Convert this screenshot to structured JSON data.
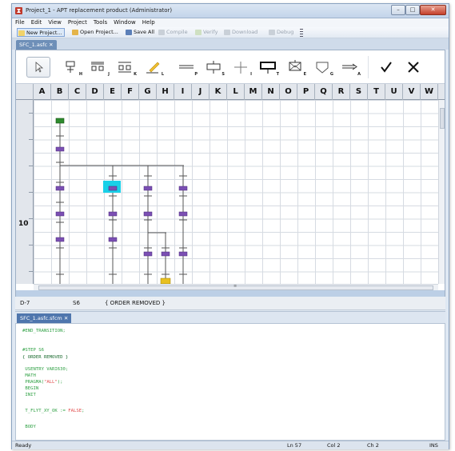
{
  "window": {
    "title": "Project_1 - APT replacement product (Administrator)"
  },
  "menu": [
    "File",
    "Edit",
    "View",
    "Project",
    "Tools",
    "Window",
    "Help"
  ],
  "toolbar": {
    "new_project": "New Project...",
    "open_project": "Open Project...",
    "save_all": "Save All",
    "compile": "Compile",
    "verify": "Verify",
    "download": "Download",
    "debug": "Debug"
  },
  "document_tab": "SFC_1.asfc",
  "palette": [
    {
      "name": "pointer",
      "key": ""
    },
    {
      "name": "step",
      "key": "H"
    },
    {
      "name": "parallel-branch",
      "key": "J"
    },
    {
      "name": "alternative-branch",
      "key": "K"
    },
    {
      "name": "comment",
      "key": "L"
    },
    {
      "name": "double-line",
      "key": "P"
    },
    {
      "name": "macro-step",
      "key": "S"
    },
    {
      "name": "cross",
      "key": "I"
    },
    {
      "name": "step-block",
      "key": "T"
    },
    {
      "name": "envelope-step",
      "key": "E"
    },
    {
      "name": "shield",
      "key": "G"
    },
    {
      "name": "jump",
      "key": "A"
    },
    {
      "name": "check",
      "key": ""
    },
    {
      "name": "cancel",
      "key": ""
    }
  ],
  "columns": [
    "A",
    "B",
    "C",
    "D",
    "E",
    "F",
    "G",
    "H",
    "I",
    "J",
    "K",
    "L",
    "M",
    "N",
    "O",
    "P",
    "Q",
    "R",
    "S",
    "T",
    "U",
    "V",
    "W"
  ],
  "row_label": "10",
  "info": {
    "cell": "D-7",
    "step": "S6",
    "comment": "{ ORDER REMOVED }"
  },
  "code_tab": "SFC_1.asfc.sfcm",
  "code_lines": [
    "#END_TRANSITION;",
    "",
    "#STEP S6",
    "{ ORDER REMOVED }",
    "",
    " USENTRY VARI630;",
    " MATH",
    " PRAGMA(\"ALL\");",
    " BEGIN",
    " INIT",
    "",
    " T_FLYT_XY_OK := FALSE;",
    "",
    " BODY"
  ],
  "status": {
    "ready": "Ready",
    "line": "Ln 57",
    "col": "Col 2",
    "ch": "Ch 2",
    "mode": "INS"
  },
  "colors": {
    "step": "#7b4fb3",
    "initial_step": "#2e8b2e",
    "selection": "#19d0e8",
    "code_green": "#2ea043"
  }
}
